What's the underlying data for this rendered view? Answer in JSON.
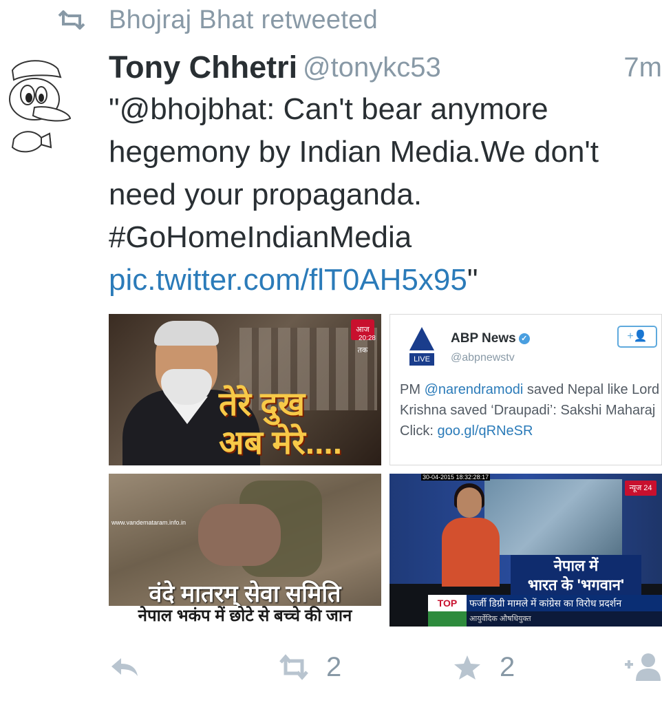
{
  "retweet_context": {
    "icon": "retweet-icon",
    "text": "Bhojraj Bhat retweeted"
  },
  "tweet": {
    "name": "Tony Chhetri",
    "handle": "@tonykc53",
    "time": "7m",
    "text_part1": "\"@bhojbhat: Can't bear anymore hegemony by Indian Media.We don't need your propaganda. #GoHomeIndianMedia",
    "link": "pic.twitter.com/flT0AH5x95",
    "text_end": "\""
  },
  "media": {
    "tile1": {
      "caption_line1": "तेरे दुख",
      "caption_line2": "अब मेरे....",
      "badge": "आज तक",
      "badge_time": "20:28"
    },
    "tile2": {
      "account_name": "ABP News",
      "account_handle": "@abpnewstv",
      "logo_text": "ABP",
      "logo_live": "LIVE",
      "follow_label": "+👤",
      "text_before": "PM ",
      "mention": "@narendramodi",
      "text_after": " saved Nepal like Lord Krishna saved ‘Draupadi’: Sakshi Maharaj",
      "click_label": "Click: ",
      "click_link": "goo.gl/qRNeSR"
    },
    "tile3": {
      "watermark": "www.vandemataram.info.in",
      "caption_line1": "वंदे मातरम् सेवा समिति",
      "caption_line2": "नेपाल भकंप में छोटे से बच्चे की जान"
    },
    "tile4": {
      "timestamp": "30-04-2015 18:32:28:17",
      "channel_logo": "न्यूज 24",
      "headline_line1": "नेपाल में",
      "headline_line2": "भारत के 'भगवान'",
      "ticker_label": "TOP NEWS",
      "ticker_text": "फर्जी डिग्री मामले में कांग्रेस का विरोध प्रदर्शन",
      "sub_strip": "आयुर्वेदिक औषधियुक्त"
    }
  },
  "actions": {
    "reply": {
      "icon": "reply-icon"
    },
    "retweet": {
      "icon": "retweet-icon",
      "count": "2"
    },
    "favorite": {
      "icon": "star-icon",
      "count": "2"
    },
    "follow": {
      "icon": "follow-user-icon"
    }
  },
  "colors": {
    "link": "#2b7bb9",
    "muted": "#8899a6",
    "text": "#292f33"
  }
}
